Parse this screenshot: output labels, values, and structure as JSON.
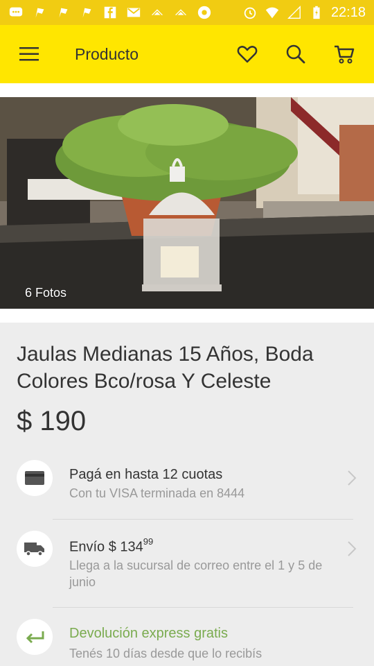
{
  "status_bar": {
    "time": "22:18",
    "icons": [
      "chat-icon",
      "flag-icon",
      "flag-icon",
      "flag-icon",
      "facebook-icon",
      "gmail-icon",
      "cloud-icon",
      "cloud-icon",
      "chrome-icon",
      "alarm-icon",
      "wifi-icon",
      "signal-icon",
      "battery-icon"
    ]
  },
  "app_bar": {
    "title": "Producto"
  },
  "gallery": {
    "photo_count": "6 Fotos"
  },
  "product": {
    "title": "Jaulas Medianas 15 Años, Boda Colores Bco/rosa Y Celeste",
    "price": "$ 190"
  },
  "payment": {
    "title": "Pagá en hasta 12 cuotas",
    "subtitle": "Con tu VISA terminada en 8444"
  },
  "shipping": {
    "title_prefix": "Envío $ 134",
    "title_cents": "99",
    "subtitle": "Llega a la sucursal de correo entre el 1 y 5 de junio"
  },
  "returns": {
    "title": "Devolución express gratis",
    "subtitle": "Tenés 10 días desde que lo recibís"
  },
  "colors": {
    "status_bar": "#f1cc12",
    "app_bar": "#ffe600",
    "return_green": "#7aab4f"
  }
}
